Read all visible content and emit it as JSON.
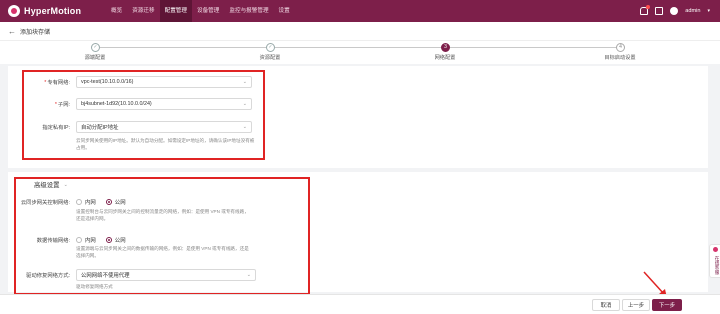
{
  "app": {
    "name": "HyperMotion"
  },
  "nav": [
    "概览",
    "资源迁移",
    "配置管理",
    "设备管理",
    "监控与报警管理",
    "设置"
  ],
  "nav_active": 2,
  "user": {
    "name": "admin"
  },
  "breadcrumb": {
    "title": "添加块存储"
  },
  "steps": [
    {
      "label": "源端配置",
      "state": "done",
      "num": ""
    },
    {
      "label": "资源配置",
      "state": "done",
      "num": ""
    },
    {
      "label": "网络配置",
      "state": "active",
      "num": "3"
    },
    {
      "label": "目标启动设置",
      "state": "todo",
      "num": "4"
    }
  ],
  "network": {
    "vpc_label": "专有网络:",
    "vpc_value": "vpc-test(10.10.0.0/16)",
    "subnet_label": "子网:",
    "subnet_value": "bj4subnet-1d92(10.10.0.0/24)",
    "ip_label": "指定私有IP:",
    "ip_value": "自动分配IP地址",
    "ip_hint": "云同步网关使用的IP地址。默认为自动分配。如需设定IP地址的，请确认该IP地址没有被占用。"
  },
  "advanced": {
    "title": "高级设置",
    "ctrl_label": "云同步网关控制网络:",
    "data_label": "数据传输网络:",
    "options": [
      "内网",
      "公网"
    ],
    "ctrl_selected": "公网",
    "data_selected": "公网",
    "ctrl_hint": "设置控制台与云同步网关之间的控制流量走的网络，例如：是使用 VPN 或专有线路，还是选择内网。",
    "data_hint": "设置源端与云同步网关之间的数据传输的网络，例如：是使用 VPN 或专有线路，还是选择内网。",
    "boot_label": "驱动修复网络方式:",
    "boot_value": "公网网络不使用代理",
    "boot_hint": "驱动修复网络方式"
  },
  "side_tab": {
    "label": "在线客服"
  },
  "footer": {
    "cancel": "取消",
    "prev": "上一步",
    "next": "下一步"
  }
}
